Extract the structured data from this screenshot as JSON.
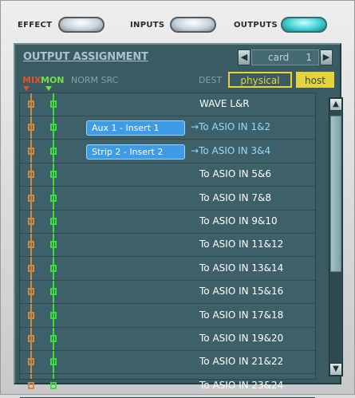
{
  "modes": {
    "effect": "EFFECT",
    "inputs": "INPUTS",
    "outputs": "OUTPUTS"
  },
  "panel": {
    "title": "OUTPUT ASSIGNMENT",
    "card_label": "card",
    "card_value": "1",
    "headers": {
      "mix": "MIX",
      "mon": "MON",
      "norm_src": "NORM SRC",
      "dest": "DEST"
    },
    "dest_physical": "physical",
    "dest_host": "host"
  },
  "rows": [
    {
      "source": "",
      "dest": "WAVE L&R",
      "arrow": false
    },
    {
      "source": "Aux 1 - Insert 1",
      "dest": "To ASIO IN 1&2",
      "arrow": true
    },
    {
      "source": "Strip 2 - Insert 2",
      "dest": "To ASIO IN 3&4",
      "arrow": true
    },
    {
      "source": "",
      "dest": "To ASIO IN 5&6",
      "arrow": false
    },
    {
      "source": "",
      "dest": "To ASIO IN 7&8",
      "arrow": false
    },
    {
      "source": "",
      "dest": "To ASIO IN 9&10",
      "arrow": false
    },
    {
      "source": "",
      "dest": "To ASIO IN 11&12",
      "arrow": false
    },
    {
      "source": "",
      "dest": "To ASIO IN 13&14",
      "arrow": false
    },
    {
      "source": "",
      "dest": "To ASIO IN 15&16",
      "arrow": false
    },
    {
      "source": "",
      "dest": "To ASIO IN 17&18",
      "arrow": false
    },
    {
      "source": "",
      "dest": "To ASIO IN 19&20",
      "arrow": false
    },
    {
      "source": "",
      "dest": "To ASIO IN 21&22",
      "arrow": false
    },
    {
      "source": "",
      "dest": "To ASIO IN 23&24",
      "arrow": false
    }
  ],
  "colors": {
    "panel": "#3b5b62",
    "mix": "#d3883c",
    "mon": "#39e03a",
    "dest_active": "#e6d23a",
    "source_tag": "#3f9be6"
  },
  "icons": {
    "card_prev": "left-arrow-icon",
    "card_next": "right-arrow-icon",
    "scroll_up": "up-arrow-icon",
    "scroll_down": "down-arrow-icon"
  }
}
